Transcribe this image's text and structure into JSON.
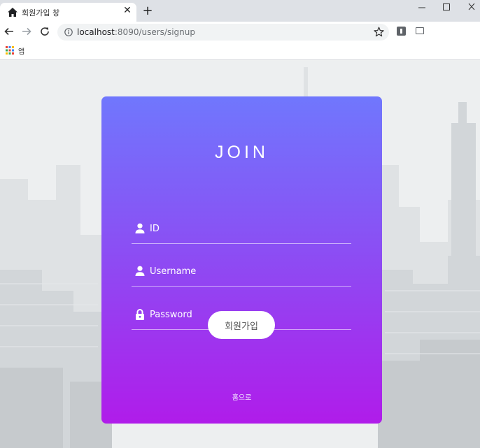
{
  "browser": {
    "tab_title": "회원가입 창",
    "url_host": "localhost",
    "url_rest": ":8090/users/signup",
    "bookmarks": {
      "apps_label": "앱"
    }
  },
  "form": {
    "title": "JOIN",
    "fields": [
      {
        "placeholder": "ID",
        "icon": "user-icon"
      },
      {
        "placeholder": "Username",
        "icon": "user-icon"
      },
      {
        "placeholder": "Password",
        "icon": "lock-icon"
      }
    ],
    "submit_label": "회원가입",
    "home_link": "홈으로"
  },
  "colors": {
    "gradient_top": "#7077fd",
    "gradient_bottom": "#b01cea",
    "button_bg": "#ffffff"
  }
}
